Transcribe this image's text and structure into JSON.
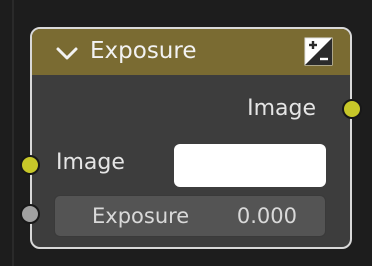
{
  "node": {
    "title": "Exposure",
    "header_color": "#7a6b32",
    "collapse_icon": "chevron-down-icon",
    "type_icon": "plus-minus-exposure-icon",
    "outputs": [
      {
        "label": "Image",
        "socket_color": "#c7c729"
      }
    ],
    "inputs": [
      {
        "label": "Image",
        "socket_color": "#c7c729",
        "color_value": "#ffffff"
      },
      {
        "label": "Exposure",
        "value": "0.000",
        "socket_color": "#a1a1a1"
      }
    ]
  }
}
